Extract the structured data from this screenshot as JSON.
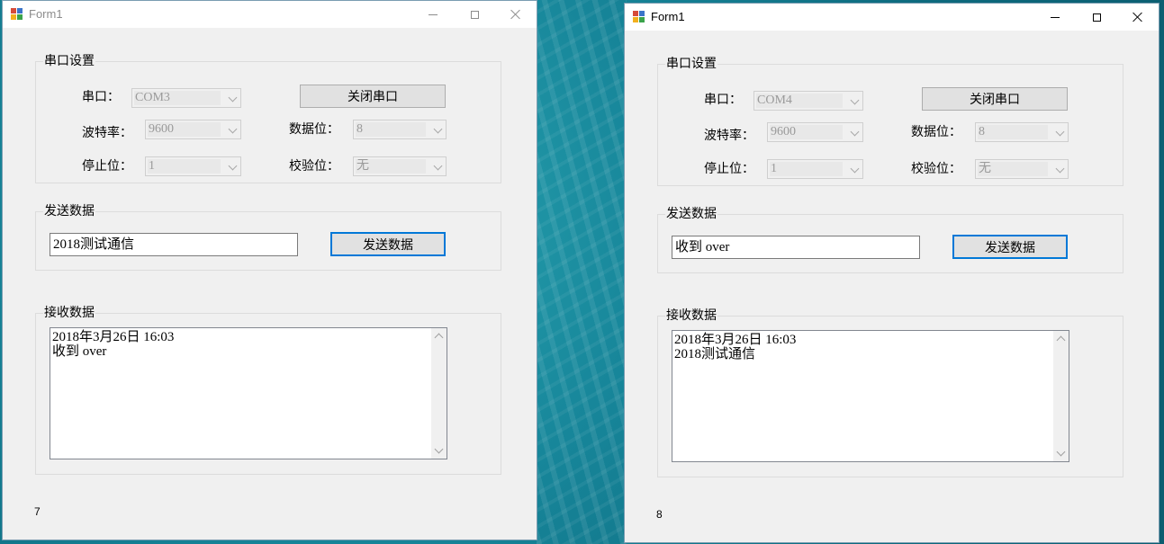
{
  "windows": [
    {
      "title": "Form1",
      "serial_group": {
        "title": "串口设置",
        "port_label": "串口：",
        "port_value": "COM3",
        "close_button": "关闭串口",
        "baud_label": "波特率：",
        "baud_value": "9600",
        "databits_label": "数据位：",
        "databits_value": "8",
        "stopbits_label": "停止位：",
        "stopbits_value": "1",
        "parity_label": "校验位：",
        "parity_value": "无"
      },
      "send_group": {
        "title": "发送数据",
        "input_value": "2018测试通信",
        "send_button": "发送数据"
      },
      "receive_group": {
        "title": "接收数据",
        "lines": [
          "2018年3月26日 16:03",
          "收到 over"
        ]
      },
      "status": "7"
    },
    {
      "title": "Form1",
      "serial_group": {
        "title": "串口设置",
        "port_label": "串口：",
        "port_value": "COM4",
        "close_button": "关闭串口",
        "baud_label": "波特率：",
        "baud_value": "9600",
        "databits_label": "数据位：",
        "databits_value": "8",
        "stopbits_label": "停止位：",
        "stopbits_value": "1",
        "parity_label": "校验位：",
        "parity_value": "无"
      },
      "send_group": {
        "title": "发送数据",
        "input_value": "收到 over",
        "send_button": "发送数据"
      },
      "receive_group": {
        "title": "接收数据",
        "lines": [
          "2018年3月26日 16:03",
          "2018测试通信"
        ]
      },
      "status": "8"
    }
  ],
  "colors": {
    "desktop": "#17869a",
    "focus_border": "#0078d7",
    "form_background": "#f0f0f0"
  }
}
